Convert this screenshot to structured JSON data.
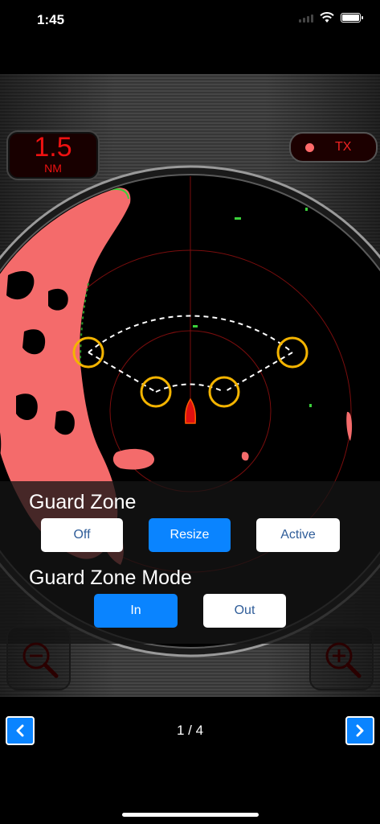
{
  "status": {
    "time": "1:45"
  },
  "range": {
    "value": "1.5",
    "unit": "NM"
  },
  "tx": {
    "label": "TX"
  },
  "guard_zone": {
    "title": "Guard Zone",
    "options": [
      "Off",
      "Resize",
      "Active"
    ],
    "selected": "Resize"
  },
  "guard_zone_mode": {
    "title": "Guard Zone Mode",
    "options": [
      "In",
      "Out"
    ],
    "selected": "In"
  },
  "pager": {
    "indicator": "1 / 4"
  },
  "colors": {
    "accent": "#0a84ff",
    "radar_echo": "#f46b6b",
    "handle": "#f4b400",
    "readout_red": "#ee1111"
  },
  "icons": [
    "signal-icon",
    "wifi-icon",
    "battery-icon",
    "zoom-out-icon",
    "zoom-in-icon",
    "chevron-left-icon",
    "chevron-right-icon",
    "boat-icon"
  ]
}
